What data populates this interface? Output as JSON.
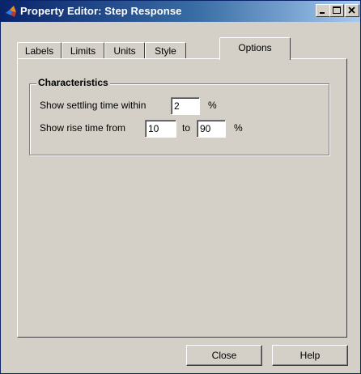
{
  "window": {
    "title": "Property Editor: Step Response",
    "icon": "matlab-icon"
  },
  "titlebar_buttons": {
    "minimize_icon": "minimize-icon",
    "maximize_icon": "maximize-icon",
    "close_icon": "close-icon"
  },
  "tabs": [
    {
      "label": "Labels",
      "active": false
    },
    {
      "label": "Limits",
      "active": false
    },
    {
      "label": "Units",
      "active": false
    },
    {
      "label": "Style",
      "active": false
    },
    {
      "label": "Options",
      "active": true
    }
  ],
  "characteristics": {
    "title": "Characteristics",
    "settling": {
      "label": "Show settling time within",
      "value": "2",
      "unit": "%"
    },
    "rise": {
      "label": "Show rise time from",
      "from_value": "10",
      "to_label": "to",
      "to_value": "90",
      "unit": "%"
    }
  },
  "buttons": {
    "close_label": "Close",
    "help_label": "Help"
  },
  "colors": {
    "titlebar_start": "#0a246a",
    "titlebar_end": "#a6caf0",
    "face": "#d4d0c8"
  }
}
